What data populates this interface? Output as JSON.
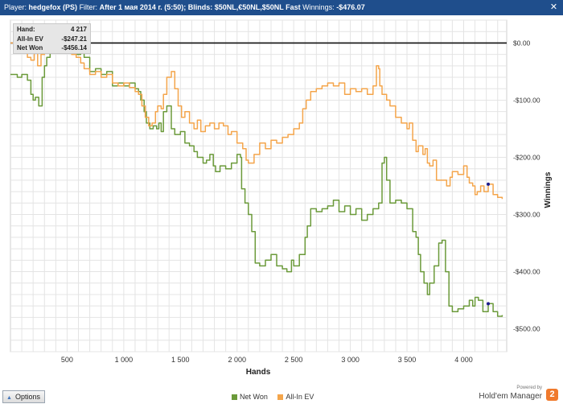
{
  "titlebar": {
    "player_label": "Player:",
    "player": "hedgefox (PS)",
    "filter_label": "Filter:",
    "filter": "After 1 мая 2014 г. (5:50); Blinds: $50NL,€50NL,$50NL Fast",
    "winnings_label": "Winnings:",
    "winnings": "-$476.07",
    "close_icon": "close-icon"
  },
  "infobox": {
    "rows": [
      {
        "label": "Hand:",
        "value": "4 217"
      },
      {
        "label": "All-In EV",
        "value": "-$247.21"
      },
      {
        "label": "Net Won",
        "value": "-$456.14"
      }
    ]
  },
  "bottom": {
    "options_label": "Options",
    "options_icon": "triangle-up-icon",
    "powered_by": "Powered by",
    "brand": "Hold'em Manager",
    "brand_badge": "2"
  },
  "colors": {
    "net_won": "#6b9a3a",
    "all_in_ev": "#f4a54b",
    "zero_line": "#111111",
    "grid": "#e4e4e4",
    "titlebar": "#1f4e8c"
  },
  "chart_data": {
    "type": "line",
    "xlabel": "Hands",
    "ylabel": "Winnings",
    "xlim": [
      0,
      4380
    ],
    "ylim": [
      -540,
      40
    ],
    "x_ticks": [
      500,
      1000,
      1500,
      2000,
      2500,
      3000,
      3500,
      4000
    ],
    "x_tick_labels": [
      "500",
      "1 000",
      "1 500",
      "2 000",
      "2 500",
      "3 000",
      "3 500",
      "4 000"
    ],
    "y_ticks": [
      0,
      -100,
      -200,
      -300,
      -400,
      -500
    ],
    "y_tick_labels": [
      "$0.00",
      "-$100.00",
      "-$200.00",
      "-$300.00",
      "-$400.00",
      "-$500.00"
    ],
    "legend_position": "bottom-center",
    "grid": true,
    "series": [
      {
        "name": "Net Won",
        "color": "#6b9a3a",
        "points": [
          [
            0,
            -55
          ],
          [
            60,
            -60
          ],
          [
            100,
            -55
          ],
          [
            150,
            -65
          ],
          [
            180,
            -90
          ],
          [
            200,
            -100
          ],
          [
            220,
            -95
          ],
          [
            250,
            -110
          ],
          [
            280,
            -60
          ],
          [
            300,
            -40
          ],
          [
            320,
            -25
          ],
          [
            350,
            0
          ],
          [
            370,
            20
          ],
          [
            390,
            32
          ],
          [
            410,
            22
          ],
          [
            430,
            10
          ],
          [
            450,
            12
          ],
          [
            480,
            20
          ],
          [
            500,
            12
          ],
          [
            520,
            -10
          ],
          [
            550,
            -5
          ],
          [
            580,
            -20
          ],
          [
            620,
            -15
          ],
          [
            650,
            -25
          ],
          [
            700,
            -50
          ],
          [
            750,
            -45
          ],
          [
            800,
            -55
          ],
          [
            850,
            -50
          ],
          [
            900,
            -75
          ],
          [
            950,
            -70
          ],
          [
            1000,
            -75
          ],
          [
            1050,
            -70
          ],
          [
            1100,
            -80
          ],
          [
            1130,
            -85
          ],
          [
            1150,
            -100
          ],
          [
            1180,
            -120
          ],
          [
            1200,
            -140
          ],
          [
            1230,
            -150
          ],
          [
            1260,
            -145
          ],
          [
            1290,
            -150
          ],
          [
            1310,
            -140
          ],
          [
            1330,
            -155
          ],
          [
            1350,
            -120
          ],
          [
            1380,
            -110
          ],
          [
            1420,
            -150
          ],
          [
            1450,
            -160
          ],
          [
            1500,
            -155
          ],
          [
            1540,
            -175
          ],
          [
            1580,
            -180
          ],
          [
            1620,
            -190
          ],
          [
            1650,
            -200
          ],
          [
            1700,
            -210
          ],
          [
            1730,
            -205
          ],
          [
            1760,
            -195
          ],
          [
            1790,
            -215
          ],
          [
            1810,
            -225
          ],
          [
            1850,
            -215
          ],
          [
            1900,
            -220
          ],
          [
            1950,
            -210
          ],
          [
            2000,
            -195
          ],
          [
            2030,
            -200
          ],
          [
            2040,
            -255
          ],
          [
            2070,
            -280
          ],
          [
            2100,
            -300
          ],
          [
            2130,
            -330
          ],
          [
            2160,
            -385
          ],
          [
            2200,
            -390
          ],
          [
            2250,
            -380
          ],
          [
            2300,
            -370
          ],
          [
            2350,
            -390
          ],
          [
            2400,
            -395
          ],
          [
            2440,
            -400
          ],
          [
            2480,
            -380
          ],
          [
            2500,
            -390
          ],
          [
            2550,
            -370
          ],
          [
            2600,
            -340
          ],
          [
            2620,
            -320
          ],
          [
            2650,
            -290
          ],
          [
            2700,
            -295
          ],
          [
            2750,
            -290
          ],
          [
            2800,
            -285
          ],
          [
            2850,
            -275
          ],
          [
            2900,
            -295
          ],
          [
            2950,
            -285
          ],
          [
            3000,
            -300
          ],
          [
            3050,
            -290
          ],
          [
            3100,
            -310
          ],
          [
            3150,
            -300
          ],
          [
            3200,
            -290
          ],
          [
            3250,
            -280
          ],
          [
            3280,
            -210
          ],
          [
            3300,
            -200
          ],
          [
            3320,
            -240
          ],
          [
            3350,
            -280
          ],
          [
            3400,
            -275
          ],
          [
            3450,
            -280
          ],
          [
            3500,
            -290
          ],
          [
            3550,
            -330
          ],
          [
            3580,
            -340
          ],
          [
            3600,
            -370
          ],
          [
            3620,
            -400
          ],
          [
            3650,
            -420
          ],
          [
            3680,
            -440
          ],
          [
            3700,
            -420
          ],
          [
            3740,
            -390
          ],
          [
            3780,
            -350
          ],
          [
            3810,
            -345
          ],
          [
            3840,
            -400
          ],
          [
            3870,
            -460
          ],
          [
            3900,
            -470
          ],
          [
            3950,
            -465
          ],
          [
            4000,
            -460
          ],
          [
            4050,
            -450
          ],
          [
            4080,
            -460
          ],
          [
            4100,
            -445
          ],
          [
            4130,
            -450
          ],
          [
            4170,
            -470
          ],
          [
            4217,
            -456
          ],
          [
            4260,
            -470
          ],
          [
            4300,
            -478
          ],
          [
            4340,
            -476
          ]
        ]
      },
      {
        "name": "All-In EV",
        "color": "#f4a54b",
        "points": [
          [
            0,
            0
          ],
          [
            40,
            -5
          ],
          [
            80,
            -10
          ],
          [
            110,
            -5
          ],
          [
            150,
            -25
          ],
          [
            180,
            -30
          ],
          [
            210,
            -15
          ],
          [
            240,
            -40
          ],
          [
            270,
            -20
          ],
          [
            300,
            -15
          ],
          [
            330,
            -5
          ],
          [
            360,
            10
          ],
          [
            390,
            25
          ],
          [
            410,
            15
          ],
          [
            440,
            5
          ],
          [
            470,
            0
          ],
          [
            500,
            -10
          ],
          [
            540,
            -20
          ],
          [
            580,
            -25
          ],
          [
            620,
            -35
          ],
          [
            650,
            -45
          ],
          [
            700,
            -55
          ],
          [
            750,
            -50
          ],
          [
            800,
            -60
          ],
          [
            850,
            -55
          ],
          [
            900,
            -70
          ],
          [
            950,
            -75
          ],
          [
            1000,
            -70
          ],
          [
            1050,
            -78
          ],
          [
            1100,
            -85
          ],
          [
            1130,
            -90
          ],
          [
            1160,
            -110
          ],
          [
            1190,
            -130
          ],
          [
            1220,
            -145
          ],
          [
            1250,
            -140
          ],
          [
            1280,
            -120
          ],
          [
            1300,
            -110
          ],
          [
            1330,
            -115
          ],
          [
            1350,
            -90
          ],
          [
            1380,
            -60
          ],
          [
            1420,
            -50
          ],
          [
            1450,
            -80
          ],
          [
            1480,
            -110
          ],
          [
            1510,
            -130
          ],
          [
            1540,
            -120
          ],
          [
            1580,
            -140
          ],
          [
            1620,
            -150
          ],
          [
            1650,
            -135
          ],
          [
            1680,
            -155
          ],
          [
            1720,
            -145
          ],
          [
            1760,
            -140
          ],
          [
            1800,
            -150
          ],
          [
            1840,
            -140
          ],
          [
            1880,
            -145
          ],
          [
            1920,
            -160
          ],
          [
            1950,
            -155
          ],
          [
            1980,
            -155
          ],
          [
            2000,
            -175
          ],
          [
            2050,
            -185
          ],
          [
            2080,
            -205
          ],
          [
            2100,
            -210
          ],
          [
            2150,
            -195
          ],
          [
            2200,
            -175
          ],
          [
            2250,
            -185
          ],
          [
            2300,
            -170
          ],
          [
            2350,
            -175
          ],
          [
            2400,
            -165
          ],
          [
            2450,
            -160
          ],
          [
            2500,
            -150
          ],
          [
            2550,
            -140
          ],
          [
            2580,
            -115
          ],
          [
            2610,
            -100
          ],
          [
            2650,
            -85
          ],
          [
            2700,
            -80
          ],
          [
            2750,
            -75
          ],
          [
            2800,
            -70
          ],
          [
            2850,
            -75
          ],
          [
            2900,
            -70
          ],
          [
            2950,
            -90
          ],
          [
            3000,
            -80
          ],
          [
            3050,
            -85
          ],
          [
            3100,
            -80
          ],
          [
            3150,
            -90
          ],
          [
            3200,
            -75
          ],
          [
            3230,
            -40
          ],
          [
            3250,
            -45
          ],
          [
            3260,
            -75
          ],
          [
            3280,
            -90
          ],
          [
            3320,
            -100
          ],
          [
            3350,
            -110
          ],
          [
            3400,
            -130
          ],
          [
            3450,
            -140
          ],
          [
            3500,
            -150
          ],
          [
            3520,
            -140
          ],
          [
            3550,
            -170
          ],
          [
            3580,
            -190
          ],
          [
            3600,
            -180
          ],
          [
            3640,
            -195
          ],
          [
            3660,
            -185
          ],
          [
            3680,
            -210
          ],
          [
            3700,
            -215
          ],
          [
            3730,
            -205
          ],
          [
            3760,
            -240
          ],
          [
            3800,
            -240
          ],
          [
            3850,
            -250
          ],
          [
            3880,
            -235
          ],
          [
            3900,
            -225
          ],
          [
            3950,
            -230
          ],
          [
            4000,
            -215
          ],
          [
            4030,
            -235
          ],
          [
            4050,
            -245
          ],
          [
            4080,
            -250
          ],
          [
            4100,
            -265
          ],
          [
            4120,
            -260
          ],
          [
            4150,
            -250
          ],
          [
            4180,
            -260
          ],
          [
            4217,
            -247
          ],
          [
            4260,
            -265
          ],
          [
            4300,
            -270
          ],
          [
            4340,
            -273
          ]
        ]
      }
    ]
  }
}
